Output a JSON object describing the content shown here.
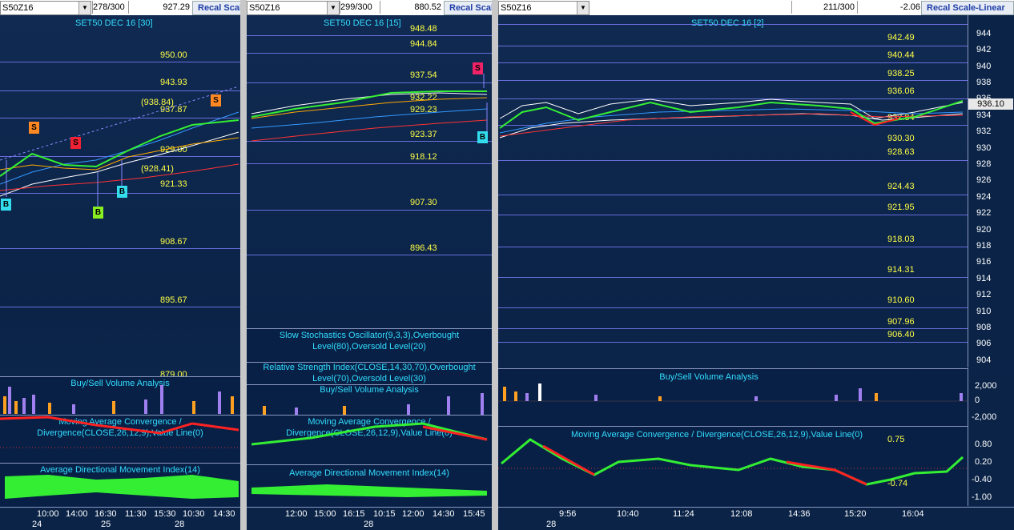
{
  "panels": [
    {
      "symbol": "S50Z16",
      "bars": "278/300",
      "price": "927.29",
      "recal": "Recal Scal",
      "title": "SET50 DEC 16  [30]",
      "levels": [
        "950.00",
        "943.93",
        "(938.84)",
        "937.87",
        "929.00",
        "(928.41)",
        "921.33",
        "908.67",
        "895.67",
        "879.00"
      ],
      "ind_titles": [
        "Buy/Sell Volume Analysis",
        "Moving Average Convergence /",
        "Divergence(CLOSE,26,12,9),Value Line(0)",
        "Average Directional Movement Index(14)"
      ],
      "times": [
        "10:00",
        "14:00",
        "16:30",
        "11:30",
        "15:30",
        "10:30",
        "14:30"
      ],
      "dates": [
        "24",
        "25",
        "28"
      ],
      "markers": [
        "B",
        "S",
        "S",
        "B",
        "B",
        "S"
      ]
    },
    {
      "symbol": "S50Z16",
      "bars": "299/300",
      "price": "880.52",
      "recal": "Recal Scal",
      "title": "SET50 DEC 16  [15]",
      "levels": [
        "948.48",
        "944.84",
        "937.54",
        "932.22",
        "929.23",
        "923.37",
        "918.12",
        "907.30",
        "896.43"
      ],
      "ind_titles": [
        "Slow Stochastics Oscillator(9,3,3),Overbought",
        "Level(80),Oversold Level(20)",
        "Relative Strength Index(CLOSE,14,30,70),Overbought",
        "Level(70),Oversold Level(30)",
        "Buy/Sell Volume Analysis",
        "Moving Average Convergence /",
        "Divergence(CLOSE,26,12,9),Value Line(0)",
        "Average Directional Movement Index(14)"
      ],
      "times": [
        "12:00",
        "15:00",
        "16:15",
        "10:15",
        "12:00",
        "14:30",
        "15:45"
      ],
      "dates": [
        "28"
      ],
      "markers": [
        "S",
        "B"
      ]
    },
    {
      "symbol": "S50Z16",
      "bars": "211/300",
      "price": "-2.06",
      "recal": "Recal Scale-Linear",
      "title": "SET50 DEC 16  [2]",
      "levels": [
        "942.49",
        "940.44",
        "938.25",
        "936.06",
        "932.84",
        "930.30",
        "928.63",
        "924.43",
        "921.95",
        "918.03",
        "914.31",
        "910.60",
        "907.96",
        "906.40"
      ],
      "axis": [
        "944",
        "942",
        "940",
        "938",
        "936",
        "934",
        "932",
        "930",
        "928",
        "926",
        "924",
        "922",
        "920",
        "918",
        "916",
        "914",
        "912",
        "910",
        "908",
        "906",
        "904"
      ],
      "last_price": "936.10",
      "vol_axis": [
        "2,000",
        "0",
        "-2,000"
      ],
      "macd_axis": [
        "0.80",
        "0.20",
        "-0.40",
        "-1.00"
      ],
      "macd_vals": [
        "0.75",
        "-0.74"
      ],
      "ind_titles": [
        "Buy/Sell Volume Analysis",
        "Moving Average Convergence / Divergence(CLOSE,26,12,9),Value Line(0)"
      ],
      "times": [
        "9:56",
        "10:40",
        "11:24",
        "12:08",
        "14:36",
        "15:20",
        "16:04"
      ],
      "dates": [
        "28"
      ]
    }
  ],
  "colors": {
    "level": "#ffff44",
    "title": "#33ddff",
    "bull": "#33ee33",
    "bear": "#ff2222",
    "vol_buy": "#ffa020",
    "vol_sell": "#a080f0"
  }
}
